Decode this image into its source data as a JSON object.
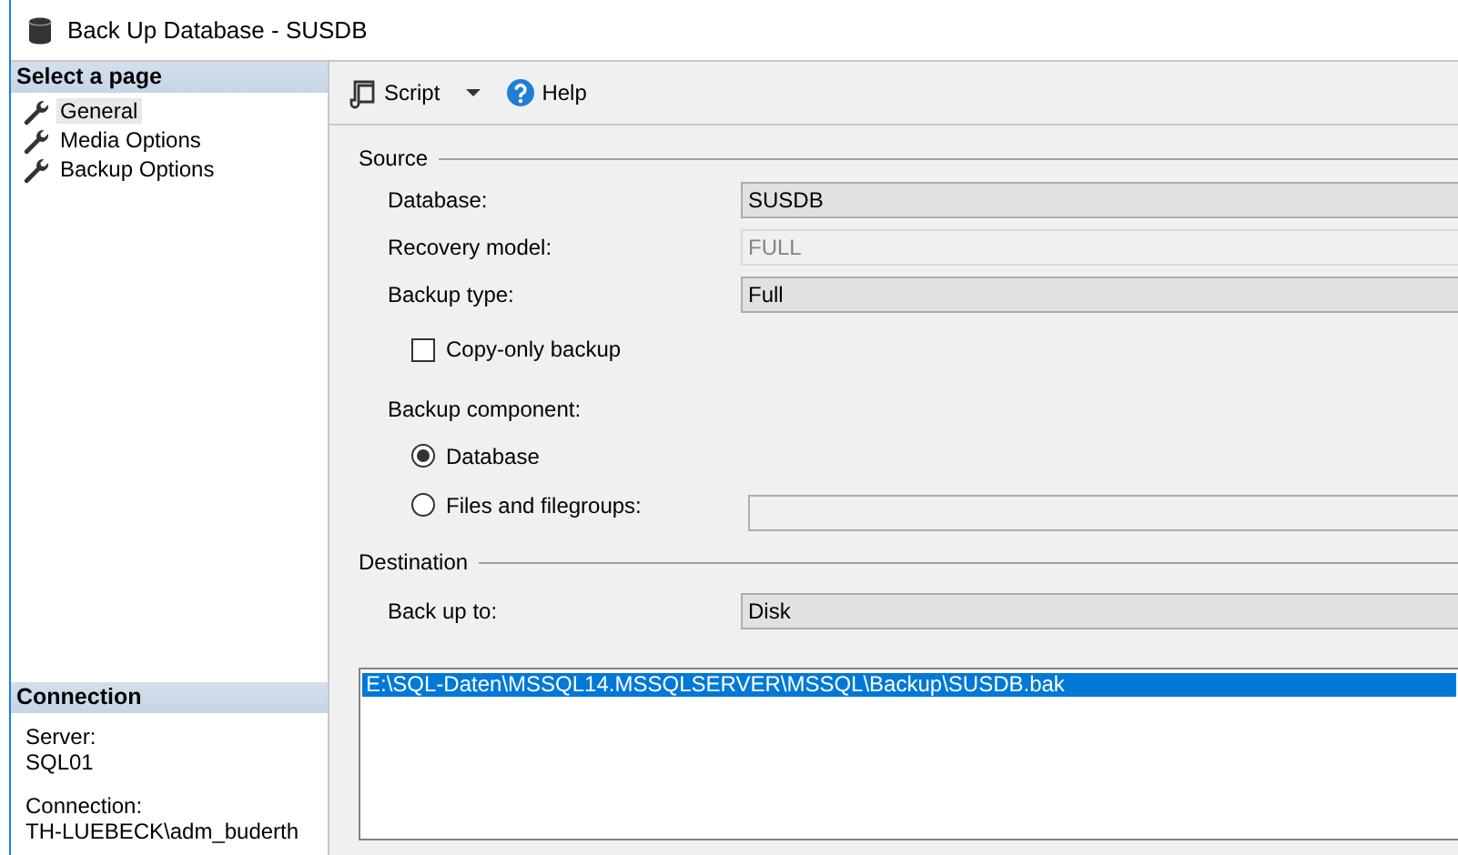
{
  "window": {
    "title": "Back Up Database - SUSDB"
  },
  "sidebar": {
    "header": "Select a page",
    "items": [
      {
        "label": "General",
        "selected": true
      },
      {
        "label": "Media Options",
        "selected": false
      },
      {
        "label": "Backup Options",
        "selected": false
      }
    ]
  },
  "connection": {
    "header": "Connection",
    "fields": [
      {
        "label": "Server:",
        "value": "SQL01"
      },
      {
        "label": "Connection:",
        "value": "TH-LUEBECK\\adm_buderth"
      }
    ]
  },
  "toolbar": [
    {
      "label": "Script",
      "kind": "script"
    },
    {
      "label": "Help",
      "kind": "help"
    }
  ],
  "source": {
    "title": "Source",
    "fields": [
      {
        "label": "Database:",
        "value": "SUSDB",
        "disabled": false
      },
      {
        "label": "Recovery model:",
        "value": "FULL",
        "disabled": true
      },
      {
        "label": "Backup type:",
        "value": "Full",
        "disabled": false
      }
    ],
    "copy_only": {
      "label": "Copy-only backup",
      "checked": false
    },
    "component": {
      "label": "Backup component:",
      "options": [
        {
          "label": "Database",
          "selected": true,
          "kind": "plain"
        },
        {
          "label": "Files and filegroups:",
          "selected": false,
          "kind": "field"
        }
      ]
    }
  },
  "destination": {
    "title": "Destination",
    "back_up_to": {
      "label": "Back up to:",
      "value": "Disk"
    },
    "paths": [
      {
        "label": "E:\\SQL-Daten\\MSSQL14.MSSQLSERVER\\MSSQL\\Backup\\SUSDB.bak",
        "selected": true
      }
    ]
  }
}
